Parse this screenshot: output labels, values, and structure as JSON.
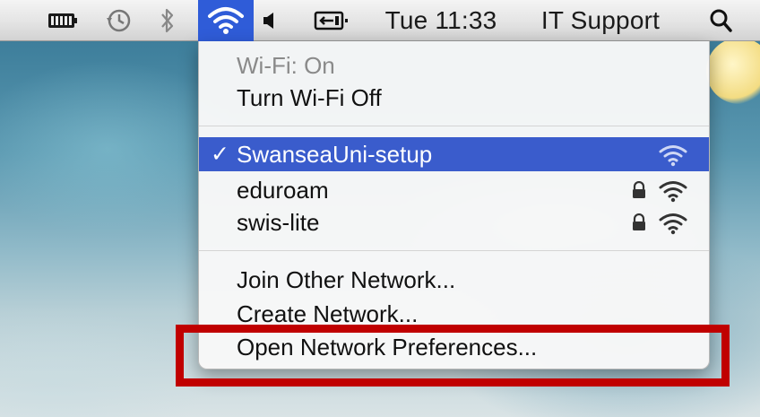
{
  "menubar": {
    "clock": "Tue 11:33",
    "user": "IT Support",
    "icons": [
      "battery-icon",
      "time-machine-icon",
      "bluetooth-icon",
      "wifi-icon",
      "volume-icon",
      "input-source-icon",
      "spotlight-search-icon"
    ]
  },
  "wifi_menu": {
    "status": "Wi-Fi: On",
    "toggle_label": "Turn Wi-Fi Off",
    "networks": [
      {
        "name": "SwanseaUni-setup",
        "connected": true,
        "locked": false
      },
      {
        "name": "eduroam",
        "connected": false,
        "locked": true
      },
      {
        "name": "swis-lite",
        "connected": false,
        "locked": true
      }
    ],
    "actions": {
      "join_other": "Join Other Network...",
      "create": "Create Network...",
      "open_prefs": "Open Network Preferences..."
    }
  },
  "colors": {
    "selection": "#3a5ccc",
    "highlight_box": "#c00000",
    "wifi_active_bg": "#2f5cd8"
  }
}
